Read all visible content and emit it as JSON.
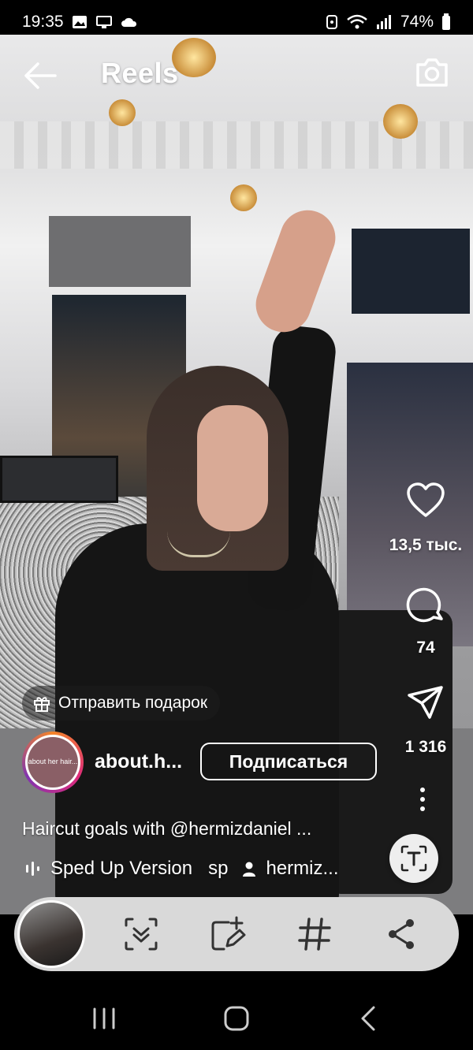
{
  "status_bar": {
    "time": "19:35",
    "battery": "74%"
  },
  "header": {
    "title": "Reels"
  },
  "actions": {
    "likes": "13,5 тыс.",
    "comments": "74",
    "shares": "1 316"
  },
  "gift_label": "Отправить подарок",
  "account": {
    "avatar_text": "about her hair...",
    "username": "about.h...",
    "follow_label": "Подписаться"
  },
  "caption": {
    "text": "Haircut goals with @hermizdaniel ..."
  },
  "audio": {
    "track": "Sped Up Version",
    "artist_short": "sp",
    "tagged_user": "hermiz..."
  },
  "toolbar": {
    "items": [
      "scan-icon",
      "add-edit-icon",
      "hashtag-icon",
      "share-icon"
    ]
  },
  "nav": {
    "items": [
      "recent-apps-icon",
      "home-icon",
      "back-icon"
    ]
  }
}
